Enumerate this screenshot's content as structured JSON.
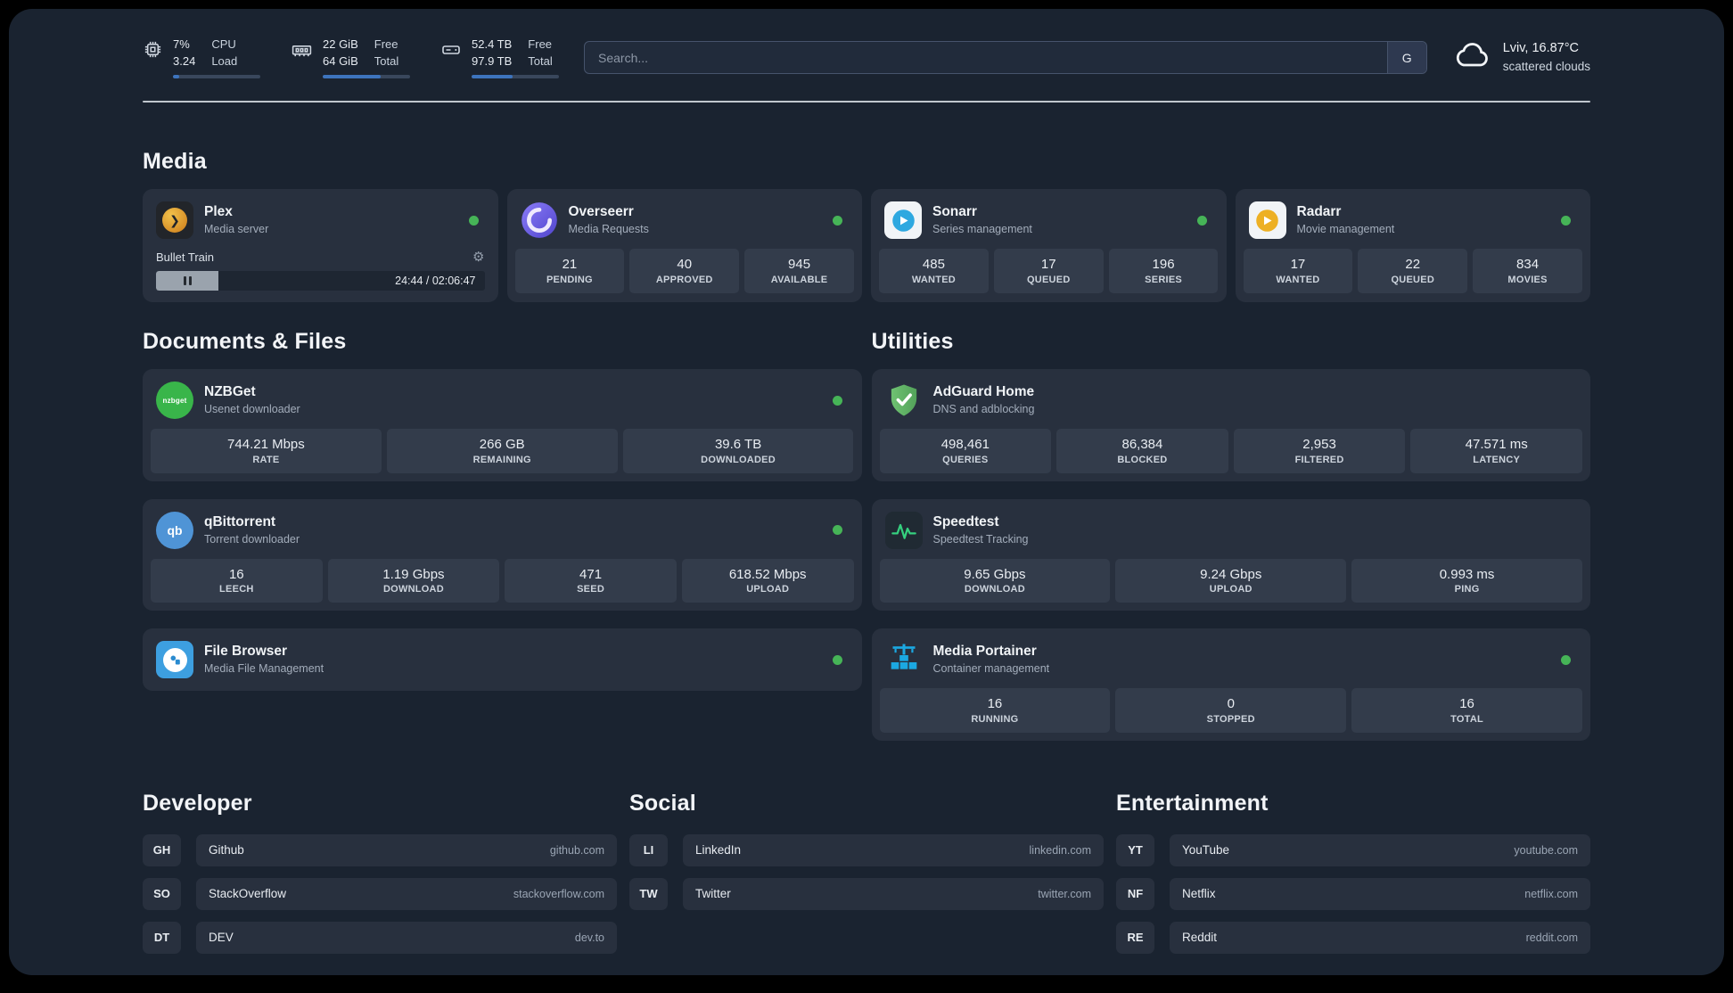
{
  "topbar": {
    "cpu": {
      "value1": "7%",
      "value2": "3.24",
      "label1": "CPU",
      "label2": "Load",
      "progress": 7
    },
    "memory": {
      "value1": "22 GiB",
      "value2": "64 GiB",
      "label1": "Free",
      "label2": "Total",
      "progress": 66
    },
    "disk": {
      "value1": "52.4 TB",
      "value2": "97.9 TB",
      "label1": "Free",
      "label2": "Total",
      "progress": 47
    },
    "search": {
      "placeholder": "Search...",
      "engine": "G"
    },
    "weather": {
      "location": "Lviv, 16.87°C",
      "condition": "scattered clouds"
    }
  },
  "sections": {
    "media": "Media",
    "documents": "Documents & Files",
    "utilities": "Utilities",
    "developer": "Developer",
    "social": "Social",
    "entertainment": "Entertainment"
  },
  "apps": {
    "plex": {
      "name": "Plex",
      "desc": "Media server",
      "now_playing": "Bullet Train",
      "time": "24:44 / 02:06:47",
      "progress": 19
    },
    "overseerr": {
      "name": "Overseerr",
      "desc": "Media Requests",
      "stats": [
        {
          "value": "21",
          "label": "PENDING"
        },
        {
          "value": "40",
          "label": "APPROVED"
        },
        {
          "value": "945",
          "label": "AVAILABLE"
        }
      ]
    },
    "sonarr": {
      "name": "Sonarr",
      "desc": "Series management",
      "stats": [
        {
          "value": "485",
          "label": "WANTED"
        },
        {
          "value": "17",
          "label": "QUEUED"
        },
        {
          "value": "196",
          "label": "SERIES"
        }
      ]
    },
    "radarr": {
      "name": "Radarr",
      "desc": "Movie management",
      "stats": [
        {
          "value": "17",
          "label": "WANTED"
        },
        {
          "value": "22",
          "label": "QUEUED"
        },
        {
          "value": "834",
          "label": "MOVIES"
        }
      ]
    },
    "nzbget": {
      "name": "NZBGet",
      "desc": "Usenet downloader",
      "icon_text": "nzbget",
      "stats": [
        {
          "value": "744.21 Mbps",
          "label": "RATE"
        },
        {
          "value": "266 GB",
          "label": "REMAINING"
        },
        {
          "value": "39.6 TB",
          "label": "DOWNLOADED"
        }
      ]
    },
    "qbittorrent": {
      "name": "qBittorrent",
      "desc": "Torrent downloader",
      "icon_text": "qb",
      "stats": [
        {
          "value": "16",
          "label": "LEECH"
        },
        {
          "value": "1.19 Gbps",
          "label": "DOWNLOAD"
        },
        {
          "value": "471",
          "label": "SEED"
        },
        {
          "value": "618.52 Mbps",
          "label": "UPLOAD"
        }
      ]
    },
    "filebrowser": {
      "name": "File Browser",
      "desc": "Media File Management"
    },
    "adguard": {
      "name": "AdGuard Home",
      "desc": "DNS and adblocking",
      "stats": [
        {
          "value": "498,461",
          "label": "QUERIES"
        },
        {
          "value": "86,384",
          "label": "BLOCKED"
        },
        {
          "value": "2,953",
          "label": "FILTERED"
        },
        {
          "value": "47.571 ms",
          "label": "LATENCY"
        }
      ]
    },
    "speedtest": {
      "name": "Speedtest",
      "desc": "Speedtest Tracking",
      "stats": [
        {
          "value": "9.65 Gbps",
          "label": "DOWNLOAD"
        },
        {
          "value": "9.24 Gbps",
          "label": "UPLOAD"
        },
        {
          "value": "0.993 ms",
          "label": "PING"
        }
      ]
    },
    "portainer": {
      "name": "Media Portainer",
      "desc": "Container management",
      "stats": [
        {
          "value": "16",
          "label": "RUNNING"
        },
        {
          "value": "0",
          "label": "STOPPED"
        },
        {
          "value": "16",
          "label": "TOTAL"
        }
      ]
    }
  },
  "bookmarks": {
    "developer": [
      {
        "abbr": "GH",
        "name": "Github",
        "domain": "github.com"
      },
      {
        "abbr": "SO",
        "name": "StackOverflow",
        "domain": "stackoverflow.com"
      },
      {
        "abbr": "DT",
        "name": "DEV",
        "domain": "dev.to"
      }
    ],
    "social": [
      {
        "abbr": "LI",
        "name": "LinkedIn",
        "domain": "linkedin.com"
      },
      {
        "abbr": "TW",
        "name": "Twitter",
        "domain": "twitter.com"
      }
    ],
    "entertainment": [
      {
        "abbr": "YT",
        "name": "YouTube",
        "domain": "youtube.com"
      },
      {
        "abbr": "NF",
        "name": "Netflix",
        "domain": "netflix.com"
      },
      {
        "abbr": "RE",
        "name": "Reddit",
        "domain": "reddit.com"
      }
    ]
  },
  "colors": {
    "background": "#1a2330",
    "card": "#28303e",
    "stat_box": "#333c4b",
    "status_green": "#46b457",
    "bar_fill": "#3d74bd"
  }
}
